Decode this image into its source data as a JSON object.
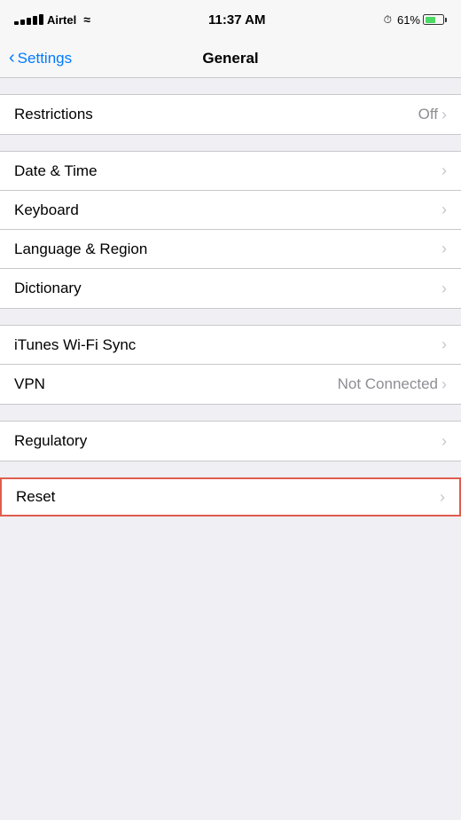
{
  "statusBar": {
    "carrier": "Airtel",
    "time": "11:37 AM",
    "battery": "61%",
    "lockSymbol": "⏰"
  },
  "navBar": {
    "backLabel": "Settings",
    "title": "General"
  },
  "sections": [
    {
      "id": "restrictions-group",
      "items": [
        {
          "id": "restrictions",
          "label": "Restrictions",
          "value": "Off",
          "hasChevron": true
        }
      ]
    },
    {
      "id": "datetime-group",
      "items": [
        {
          "id": "date-time",
          "label": "Date & Time",
          "value": "",
          "hasChevron": true
        },
        {
          "id": "keyboard",
          "label": "Keyboard",
          "value": "",
          "hasChevron": true
        },
        {
          "id": "language-region",
          "label": "Language & Region",
          "value": "",
          "hasChevron": true
        },
        {
          "id": "dictionary",
          "label": "Dictionary",
          "value": "",
          "hasChevron": true
        }
      ]
    },
    {
      "id": "vpn-group",
      "items": [
        {
          "id": "itunes-wifi-sync",
          "label": "iTunes Wi-Fi Sync",
          "value": "",
          "hasChevron": true
        },
        {
          "id": "vpn",
          "label": "VPN",
          "value": "Not Connected",
          "hasChevron": true
        }
      ]
    },
    {
      "id": "regulatory-group",
      "items": [
        {
          "id": "regulatory",
          "label": "Regulatory",
          "value": "",
          "hasChevron": true
        }
      ]
    }
  ],
  "resetItem": {
    "label": "Reset",
    "hasChevron": true
  },
  "labels": {
    "chevron": "›",
    "backChevron": "‹"
  }
}
